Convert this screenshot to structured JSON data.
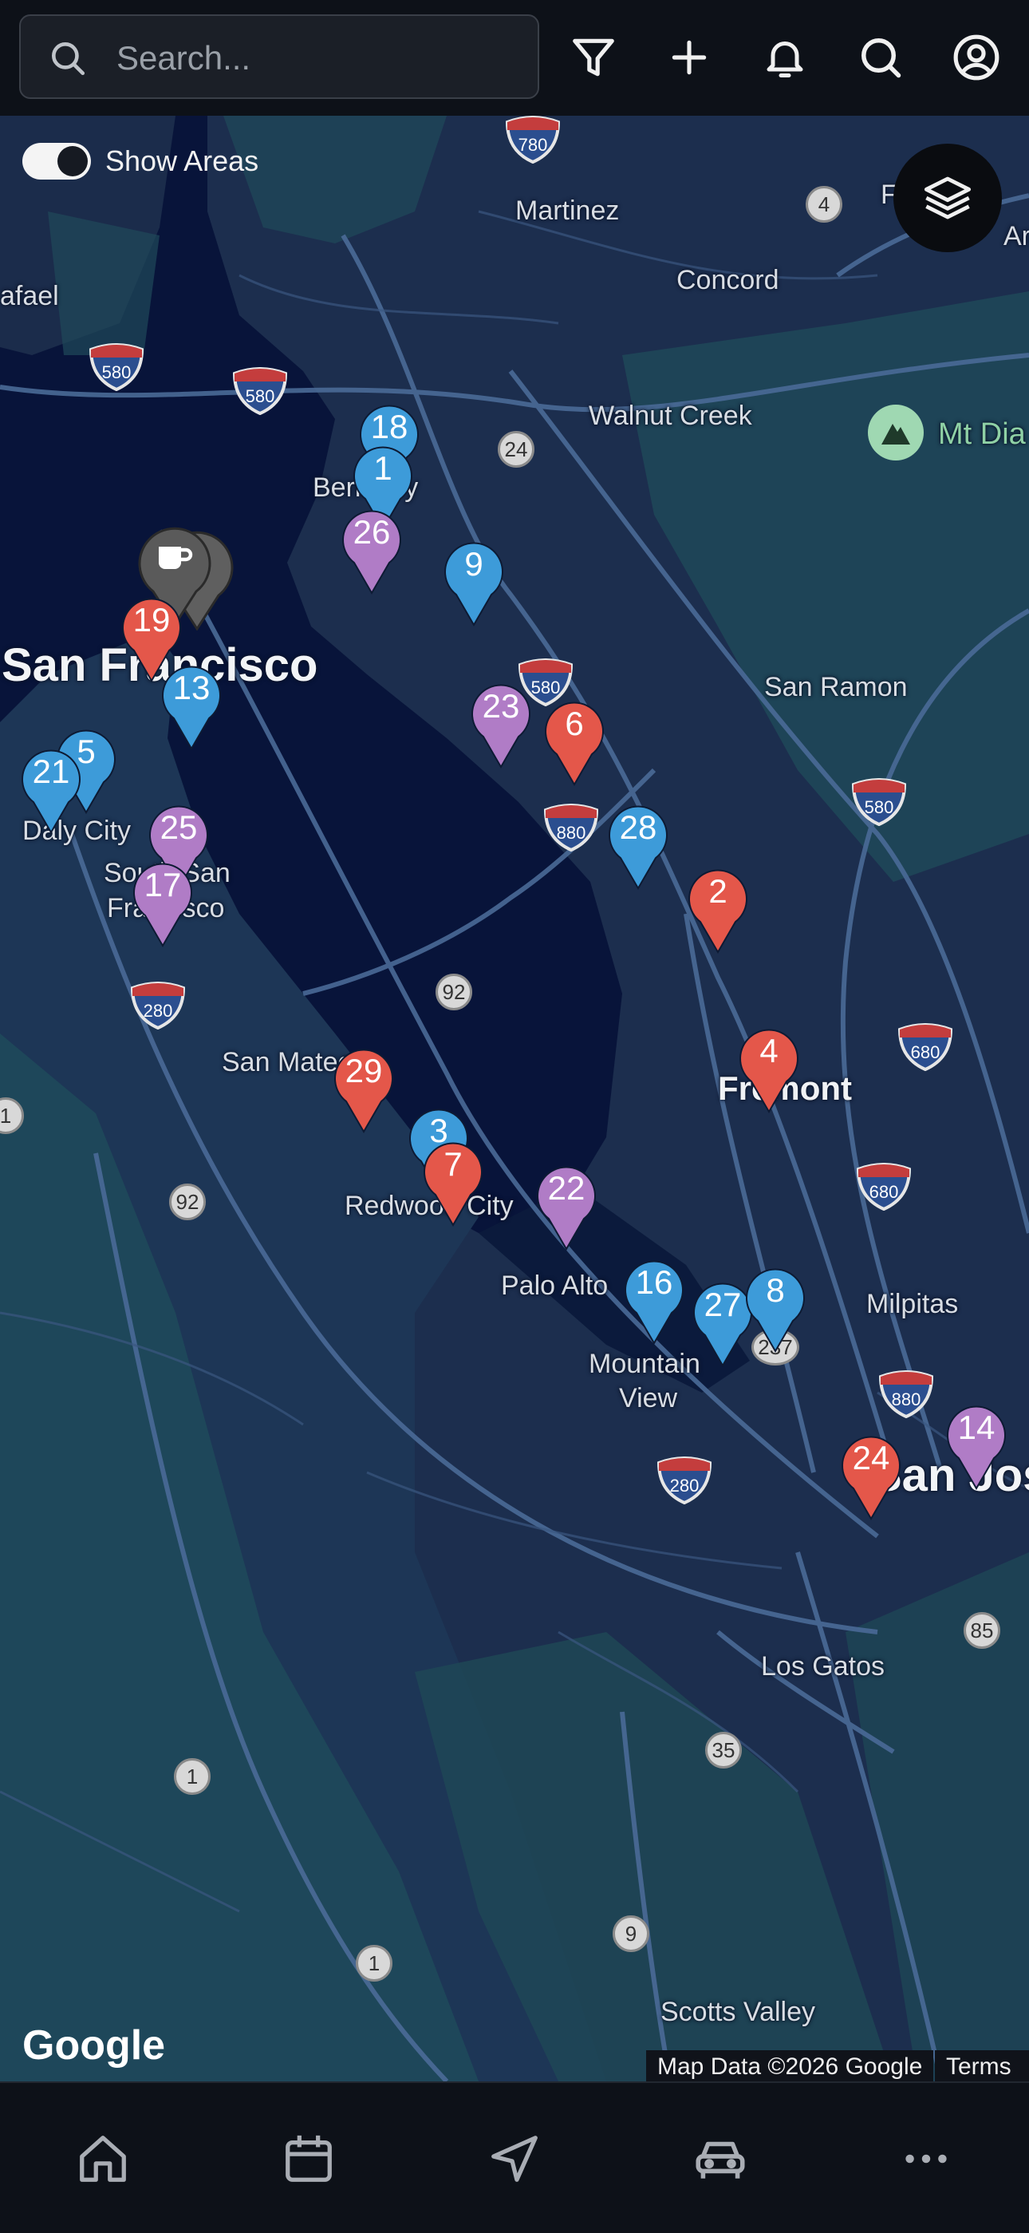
{
  "search": {
    "placeholder": "Search..."
  },
  "map": {
    "toggle_label": "Show Areas",
    "google_logo": "Google",
    "attribution": "Map Data ©2026 Google",
    "terms": "Terms",
    "places": {
      "martinez": "Martinez",
      "concord": "Concord",
      "walnut_creek": "Walnut Creek",
      "mt_diablo": "Mt Dia",
      "berkeley": "Berkeley",
      "rafael": "afael",
      "san_francisco": "San Francisco",
      "san_ramon": "San Ramon",
      "daly_city": "Daly City",
      "south_sf_1": "South San",
      "south_sf_2": "Francisco",
      "san_mateo": "San Mateo",
      "fremont": "Fremont",
      "redwood_city": "Redwood City",
      "palo_alto": "Palo Alto",
      "milpitas": "Milpitas",
      "mountain_1": "Mountain",
      "mountain_2": "View",
      "san_jose": "San Jose",
      "los_gatos": "Los Gatos",
      "scotts_valley": "Scotts Valley",
      "edge_f": "F",
      "edge_ar": "Ar"
    },
    "routes": {
      "i780": "780",
      "i580a": "580",
      "i580b": "580",
      "i580c": "580",
      "i580d": "580",
      "i880a": "880",
      "i880b": "880",
      "i280a": "280",
      "i280b": "280",
      "i680a": "680",
      "i680b": "680",
      "r4": "4",
      "r24": "24",
      "r92a": "92",
      "r92b": "92",
      "r1a": "1",
      "r1b": "1",
      "r1c": "1",
      "r237": "237",
      "r85": "85",
      "r35": "35",
      "r9": "9"
    },
    "pins": [
      {
        "n": "18",
        "color": "#3d9bd9"
      },
      {
        "n": "1",
        "color": "#3d9bd9"
      },
      {
        "n": "26",
        "color": "#b07cc6"
      },
      {
        "n": "9",
        "color": "#3d9bd9"
      },
      {
        "n": "19",
        "color": "#e4574a"
      },
      {
        "n": "13",
        "color": "#3d9bd9"
      },
      {
        "n": "23",
        "color": "#b07cc6"
      },
      {
        "n": "6",
        "color": "#e4574a"
      },
      {
        "n": "5",
        "color": "#3d9bd9"
      },
      {
        "n": "21",
        "color": "#3d9bd9"
      },
      {
        "n": "25",
        "color": "#b07cc6"
      },
      {
        "n": "17",
        "color": "#b07cc6"
      },
      {
        "n": "28",
        "color": "#3d9bd9"
      },
      {
        "n": "2",
        "color": "#e4574a"
      },
      {
        "n": "4",
        "color": "#e4574a"
      },
      {
        "n": "29",
        "color": "#e4574a"
      },
      {
        "n": "3",
        "color": "#3d9bd9"
      },
      {
        "n": "7",
        "color": "#e4574a"
      },
      {
        "n": "22",
        "color": "#b07cc6"
      },
      {
        "n": "16",
        "color": "#3d9bd9"
      },
      {
        "n": "27",
        "color": "#3d9bd9"
      },
      {
        "n": "8",
        "color": "#3d9bd9"
      },
      {
        "n": "14",
        "color": "#b07cc6"
      },
      {
        "n": "24",
        "color": "#e4574a"
      }
    ]
  }
}
